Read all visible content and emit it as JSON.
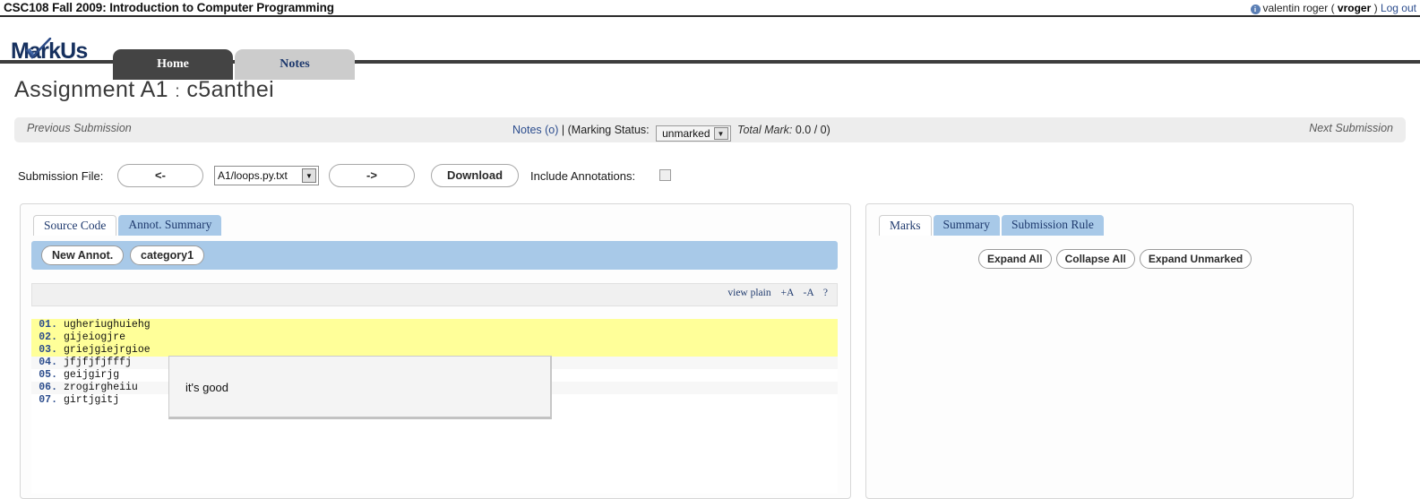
{
  "header": {
    "course_title": "CSC108 Fall 2009: Introduction to Computer Programming",
    "info_icon": "info-icon",
    "user_name": "valentin roger",
    "paren_open": "(",
    "user_id": "vroger",
    "paren_close": ")",
    "logout_label": "Log out"
  },
  "brand": {
    "logo_text": "arkUs",
    "logo_initial": "M"
  },
  "nav": {
    "tabs": [
      {
        "label": "Home",
        "active": true
      },
      {
        "label": "Notes",
        "active": false
      }
    ]
  },
  "page": {
    "assignment_title": "Assignment A1",
    "separator": ":",
    "group_name": "c5anthei"
  },
  "info_bar": {
    "previous_submission": "Previous Submission",
    "next_submission": "Next Submission",
    "notes_link": "Notes (o)",
    "pipe": "|",
    "marking_status_label": "(Marking Status:",
    "marking_status_value": "unmarked",
    "select_arrow": "▼",
    "total_mark_label": "Total Mark:",
    "total_mark_value": "0.0 / 0)"
  },
  "file_row": {
    "submission_file_label": "Submission File:",
    "prev_file_label": "<-",
    "next_file_label": "->",
    "selected_file": "A1/loops.py.txt",
    "select_arrow": "▼",
    "download_label": "Download",
    "include_annotations_label": "Include Annotations:",
    "include_annotations_checked": false
  },
  "left_panel": {
    "tabs": [
      {
        "label": "Source Code",
        "active": true
      },
      {
        "label": "Annot. Summary",
        "active": false
      }
    ],
    "toolbar": {
      "new_annot_label": "New Annot.",
      "category_label": "category1"
    },
    "view_links": {
      "view_plain": "view plain",
      "increase_font": "+A",
      "decrease_font": "-A",
      "help": "?"
    },
    "code_lines": [
      {
        "num": "01.",
        "text": "ugheriughuiehg",
        "highlight": true
      },
      {
        "num": "02.",
        "text": "gijeiogjre",
        "highlight": true
      },
      {
        "num": "03.",
        "text": "griejgiejrgioe",
        "highlight": true
      },
      {
        "num": "04.",
        "text": "jfjfjfjfffj",
        "highlight": false
      },
      {
        "num": "05.",
        "text": "geijgirjg",
        "highlight": false
      },
      {
        "num": "06.",
        "text": "zrogirgheiiu",
        "highlight": false
      },
      {
        "num": "07.",
        "text": "girtjgitj",
        "highlight": false
      }
    ],
    "tooltip_text": "it's good"
  },
  "right_panel": {
    "tabs": [
      {
        "label": "Marks",
        "active": true
      },
      {
        "label": "Summary",
        "active": false
      },
      {
        "label": "Submission Rule",
        "active": false
      }
    ],
    "buttons": {
      "expand_all": "Expand All",
      "collapse_all": "Collapse All",
      "expand_unmarked": "Expand Unmarked"
    }
  },
  "colors": {
    "accent_blue": "#a8c9e8",
    "link_navy": "#2c4d8e",
    "highlight_yellow": "#ffff99",
    "nav_active": "#444444",
    "nav_inactive": "#cccccc"
  }
}
